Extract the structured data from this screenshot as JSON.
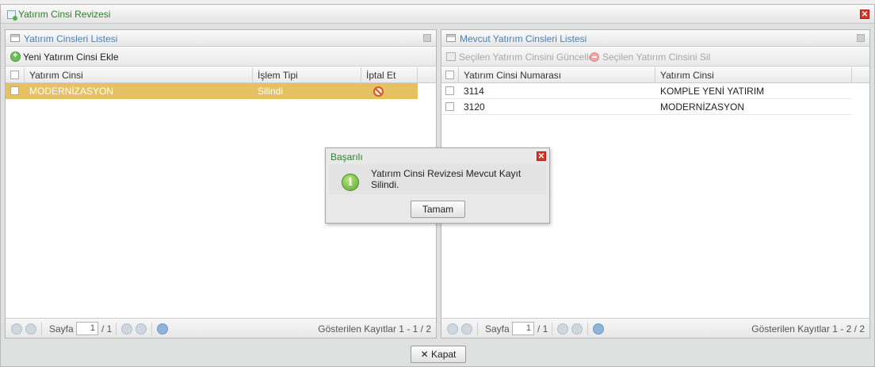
{
  "window": {
    "title": "Yatırım Cinsi Revizesi"
  },
  "left_panel": {
    "title": "Yatırım Cinsleri Listesi",
    "toolbar": {
      "add_label": "Yeni Yatırım Cinsi Ekle"
    },
    "columns": [
      "Yatırım Cinsi",
      "İşlem Tipi",
      "İptal Et"
    ],
    "rows": [
      {
        "cinsi": "MODERNİZASYON",
        "islem_tipi": "Silindi",
        "iptal_icon": "cancel-icon"
      }
    ],
    "pager": {
      "page_label": "Sayfa",
      "page_value": "1",
      "page_total": "/ 1",
      "info": "Gösterilen Kayıtlar 1 - 1 / 2"
    }
  },
  "right_panel": {
    "title": "Mevcut Yatırım Cinsleri Listesi",
    "toolbar": {
      "update_label": "Seçilen Yatırım Cinsini Güncelle",
      "delete_label": "Seçilen Yatırım Cinsini Sil"
    },
    "columns": [
      "Yatırım Cinsi Numarası",
      "Yatırım Cinsi"
    ],
    "rows": [
      {
        "numara": "3114",
        "cinsi": "KOMPLE YENİ YATIRIM"
      },
      {
        "numara": "3120",
        "cinsi": "MODERNİZASYON"
      }
    ],
    "pager": {
      "page_label": "Sayfa",
      "page_value": "1",
      "page_total": "/ 1",
      "info": "Gösterilen Kayıtlar 1 - 2 / 2"
    }
  },
  "footer": {
    "close_label": "✕ Kapat"
  },
  "dialog": {
    "title": "Başarılı",
    "message": "Yatırım Cinsi Revizesi Mevcut Kayıt Silindi.",
    "ok_label": "Tamam",
    "icon_glyph": "i"
  },
  "colors": {
    "selected_row": "#e6c163",
    "title_green": "#2d7f2d",
    "panel_title_blue": "#4a7fb5",
    "close_red": "#d9342b"
  }
}
